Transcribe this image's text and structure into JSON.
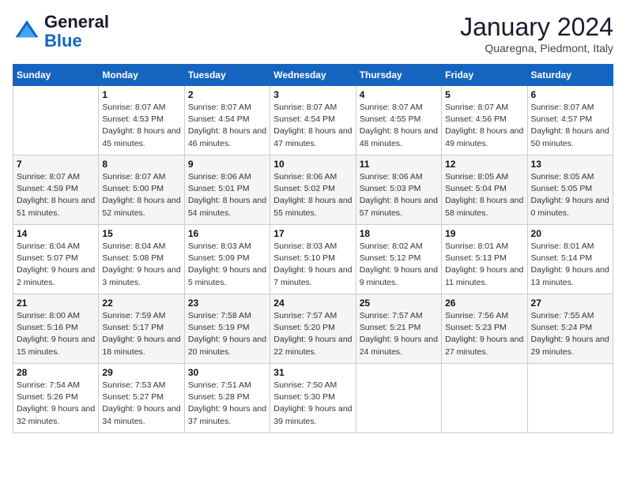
{
  "logo": {
    "line1": "General",
    "line2": "Blue"
  },
  "header": {
    "month": "January 2024",
    "location": "Quaregna, Piedmont, Italy"
  },
  "weekdays": [
    "Sunday",
    "Monday",
    "Tuesday",
    "Wednesday",
    "Thursday",
    "Friday",
    "Saturday"
  ],
  "weeks": [
    [
      null,
      {
        "day": 1,
        "sunrise": "8:07 AM",
        "sunset": "4:53 PM",
        "daylight": "8 hours and 45 minutes."
      },
      {
        "day": 2,
        "sunrise": "8:07 AM",
        "sunset": "4:54 PM",
        "daylight": "8 hours and 46 minutes."
      },
      {
        "day": 3,
        "sunrise": "8:07 AM",
        "sunset": "4:54 PM",
        "daylight": "8 hours and 47 minutes."
      },
      {
        "day": 4,
        "sunrise": "8:07 AM",
        "sunset": "4:55 PM",
        "daylight": "8 hours and 48 minutes."
      },
      {
        "day": 5,
        "sunrise": "8:07 AM",
        "sunset": "4:56 PM",
        "daylight": "8 hours and 49 minutes."
      },
      {
        "day": 6,
        "sunrise": "8:07 AM",
        "sunset": "4:57 PM",
        "daylight": "8 hours and 50 minutes."
      }
    ],
    [
      {
        "day": 7,
        "sunrise": "8:07 AM",
        "sunset": "4:59 PM",
        "daylight": "8 hours and 51 minutes."
      },
      {
        "day": 8,
        "sunrise": "8:07 AM",
        "sunset": "5:00 PM",
        "daylight": "8 hours and 52 minutes."
      },
      {
        "day": 9,
        "sunrise": "8:06 AM",
        "sunset": "5:01 PM",
        "daylight": "8 hours and 54 minutes."
      },
      {
        "day": 10,
        "sunrise": "8:06 AM",
        "sunset": "5:02 PM",
        "daylight": "8 hours and 55 minutes."
      },
      {
        "day": 11,
        "sunrise": "8:06 AM",
        "sunset": "5:03 PM",
        "daylight": "8 hours and 57 minutes."
      },
      {
        "day": 12,
        "sunrise": "8:05 AM",
        "sunset": "5:04 PM",
        "daylight": "8 hours and 58 minutes."
      },
      {
        "day": 13,
        "sunrise": "8:05 AM",
        "sunset": "5:05 PM",
        "daylight": "9 hours and 0 minutes."
      }
    ],
    [
      {
        "day": 14,
        "sunrise": "8:04 AM",
        "sunset": "5:07 PM",
        "daylight": "9 hours and 2 minutes."
      },
      {
        "day": 15,
        "sunrise": "8:04 AM",
        "sunset": "5:08 PM",
        "daylight": "9 hours and 3 minutes."
      },
      {
        "day": 16,
        "sunrise": "8:03 AM",
        "sunset": "5:09 PM",
        "daylight": "9 hours and 5 minutes."
      },
      {
        "day": 17,
        "sunrise": "8:03 AM",
        "sunset": "5:10 PM",
        "daylight": "9 hours and 7 minutes."
      },
      {
        "day": 18,
        "sunrise": "8:02 AM",
        "sunset": "5:12 PM",
        "daylight": "9 hours and 9 minutes."
      },
      {
        "day": 19,
        "sunrise": "8:01 AM",
        "sunset": "5:13 PM",
        "daylight": "9 hours and 11 minutes."
      },
      {
        "day": 20,
        "sunrise": "8:01 AM",
        "sunset": "5:14 PM",
        "daylight": "9 hours and 13 minutes."
      }
    ],
    [
      {
        "day": 21,
        "sunrise": "8:00 AM",
        "sunset": "5:16 PM",
        "daylight": "9 hours and 15 minutes."
      },
      {
        "day": 22,
        "sunrise": "7:59 AM",
        "sunset": "5:17 PM",
        "daylight": "9 hours and 18 minutes."
      },
      {
        "day": 23,
        "sunrise": "7:58 AM",
        "sunset": "5:19 PM",
        "daylight": "9 hours and 20 minutes."
      },
      {
        "day": 24,
        "sunrise": "7:57 AM",
        "sunset": "5:20 PM",
        "daylight": "9 hours and 22 minutes."
      },
      {
        "day": 25,
        "sunrise": "7:57 AM",
        "sunset": "5:21 PM",
        "daylight": "9 hours and 24 minutes."
      },
      {
        "day": 26,
        "sunrise": "7:56 AM",
        "sunset": "5:23 PM",
        "daylight": "9 hours and 27 minutes."
      },
      {
        "day": 27,
        "sunrise": "7:55 AM",
        "sunset": "5:24 PM",
        "daylight": "9 hours and 29 minutes."
      }
    ],
    [
      {
        "day": 28,
        "sunrise": "7:54 AM",
        "sunset": "5:26 PM",
        "daylight": "9 hours and 32 minutes."
      },
      {
        "day": 29,
        "sunrise": "7:53 AM",
        "sunset": "5:27 PM",
        "daylight": "9 hours and 34 minutes."
      },
      {
        "day": 30,
        "sunrise": "7:51 AM",
        "sunset": "5:28 PM",
        "daylight": "9 hours and 37 minutes."
      },
      {
        "day": 31,
        "sunrise": "7:50 AM",
        "sunset": "5:30 PM",
        "daylight": "9 hours and 39 minutes."
      },
      null,
      null,
      null
    ]
  ],
  "labels": {
    "sunrise": "Sunrise:",
    "sunset": "Sunset:",
    "daylight": "Daylight:"
  }
}
